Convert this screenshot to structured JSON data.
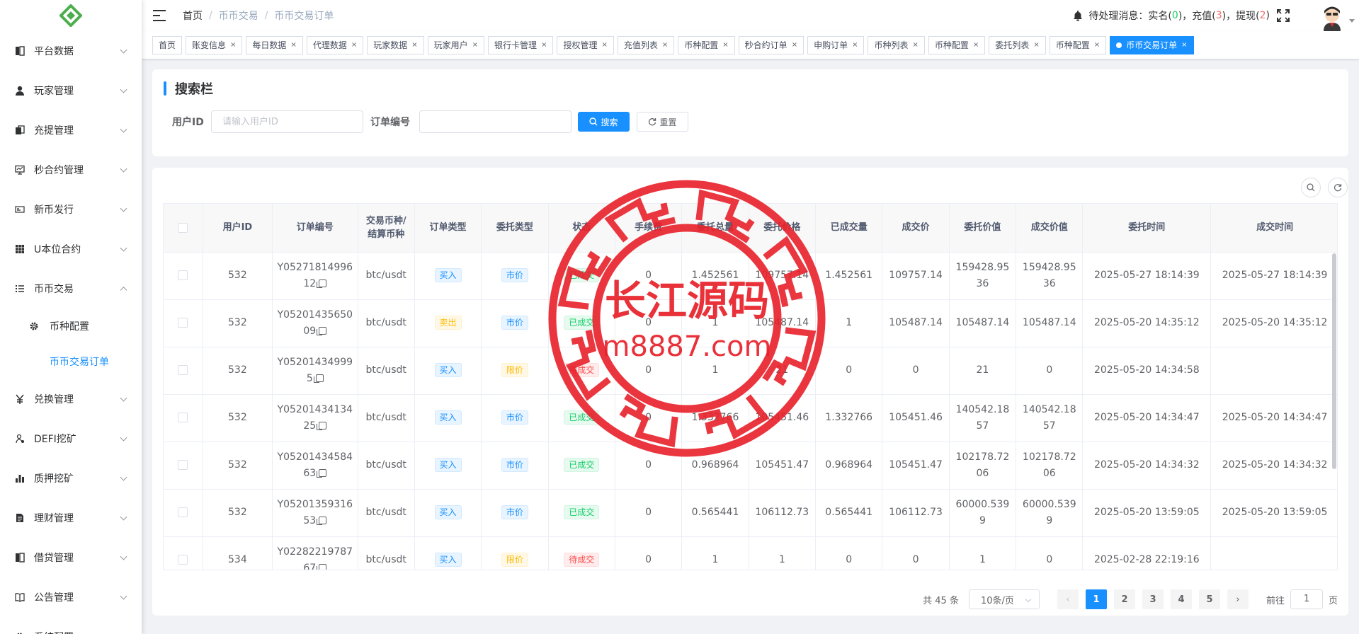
{
  "sidebar": {
    "menu": [
      {
        "label": "平台数据",
        "icon": "book-icon"
      },
      {
        "label": "玩家管理",
        "icon": "user-icon"
      },
      {
        "label": "充提管理",
        "icon": "copy-icon"
      },
      {
        "label": "秒合约管理",
        "icon": "monitor-icon"
      },
      {
        "label": "新币发行",
        "icon": "bank-icon"
      },
      {
        "label": "U本位合约",
        "icon": "grid-icon"
      },
      {
        "label": "币币交易",
        "icon": "list-icon"
      },
      {
        "label": "兑换管理",
        "icon": "yen-icon"
      },
      {
        "label": "DEFI挖矿",
        "icon": "coin-icon"
      },
      {
        "label": "质押挖矿",
        "icon": "bar-chart-icon"
      },
      {
        "label": "理财管理",
        "icon": "document-icon"
      },
      {
        "label": "借贷管理",
        "icon": "book-icon"
      },
      {
        "label": "公告管理",
        "icon": "open-book-icon"
      },
      {
        "label": "系统配置",
        "icon": "gear-icon"
      }
    ],
    "submenu": [
      {
        "label": "币种配置",
        "icon": "gear-icon"
      },
      {
        "label": "币币交易订单",
        "active": true
      }
    ]
  },
  "navbar": {
    "breadcrumb": [
      "首页",
      "币币交易",
      "币币交易订单"
    ],
    "notice": {
      "prefix": "待处理消息：实名(",
      "realname": "0",
      "mid1": ")，充值(",
      "recharge": "3",
      "mid2": ")，提现(",
      "withdraw": "2",
      "suffix": ")"
    }
  },
  "tags": [
    "首页",
    "账变信息",
    "每日数据",
    "代理数据",
    "玩家数据",
    "玩家用户",
    "银行卡管理",
    "授权管理",
    "充值列表",
    "币种配置",
    "秒合约订单",
    "申购订单",
    "币种列表",
    "币种配置",
    "委托列表",
    "币种配置",
    "币币交易订单"
  ],
  "search": {
    "title": "搜索栏",
    "user_id_label": "用户ID",
    "user_id_placeholder": "请输入用户ID",
    "order_no_label": "订单编号",
    "order_no_value": "",
    "search_button": "搜索",
    "reset_button": "重置"
  },
  "table": {
    "columns": [
      "用户ID",
      "订单编号",
      "交易币种/结算币种",
      "订单类型",
      "委托类型",
      "状态",
      "手续费",
      "委托总量",
      "委托价格",
      "已成交量",
      "成交价",
      "委托价值",
      "成交价值",
      "委托时间",
      "成交时间"
    ],
    "rows": [
      {
        "user_id": "532",
        "order_no": "Y0527181499612",
        "pair": "btc/usdt",
        "order_type": "买入",
        "entrust_type": "市价",
        "status": "已成交",
        "fee": "0",
        "total": "1.452561",
        "price": "109757.14",
        "filled": "1.452561",
        "deal_price": "109757.14",
        "entrust_value": "159428.9536",
        "deal_value": "159428.9536",
        "entrust_time": "2025-05-27 18:14:39",
        "deal_time": "2025-05-27 18:14:39"
      },
      {
        "user_id": "532",
        "order_no": "Y0520143565009",
        "pair": "btc/usdt",
        "order_type": "卖出",
        "entrust_type": "市价",
        "status": "已成交",
        "fee": "0",
        "total": "1",
        "price": "105487.14",
        "filled": "1",
        "deal_price": "105487.14",
        "entrust_value": "105487.14",
        "deal_value": "105487.14",
        "entrust_time": "2025-05-20 14:35:12",
        "deal_time": "2025-05-20 14:35:12"
      },
      {
        "user_id": "532",
        "order_no": "Y052014349995",
        "pair": "btc/usdt",
        "order_type": "买入",
        "entrust_type": "限价",
        "status": "待成交",
        "fee": "0",
        "total": "1",
        "price": "21",
        "filled": "0",
        "deal_price": "0",
        "entrust_value": "21",
        "deal_value": "0",
        "entrust_time": "2025-05-20 14:34:58",
        "deal_time": ""
      },
      {
        "user_id": "532",
        "order_no": "Y0520143413425",
        "pair": "btc/usdt",
        "order_type": "买入",
        "entrust_type": "市价",
        "status": "已成交",
        "fee": "0",
        "total": "1.332766",
        "price": "105451.46",
        "filled": "1.332766",
        "deal_price": "105451.46",
        "entrust_value": "140542.1857",
        "deal_value": "140542.1857",
        "entrust_time": "2025-05-20 14:34:47",
        "deal_time": "2025-05-20 14:34:47"
      },
      {
        "user_id": "532",
        "order_no": "Y0520143458463",
        "pair": "btc/usdt",
        "order_type": "买入",
        "entrust_type": "市价",
        "status": "已成交",
        "fee": "0",
        "total": "0.968964",
        "price": "105451.47",
        "filled": "0.968964",
        "deal_price": "105451.47",
        "entrust_value": "102178.7206",
        "deal_value": "102178.7206",
        "entrust_time": "2025-05-20 14:34:32",
        "deal_time": "2025-05-20 14:34:32"
      },
      {
        "user_id": "532",
        "order_no": "Y0520135931653",
        "pair": "btc/usdt",
        "order_type": "买入",
        "entrust_type": "市价",
        "status": "已成交",
        "fee": "0",
        "total": "0.565441",
        "price": "106112.73",
        "filled": "0.565441",
        "deal_price": "106112.73",
        "entrust_value": "60000.5399",
        "deal_value": "60000.5399",
        "entrust_time": "2025-05-20 13:59:05",
        "deal_time": "2025-05-20 13:59:05"
      },
      {
        "user_id": "534",
        "order_no": "Y0228221978767",
        "pair": "btc/usdt",
        "order_type": "买入",
        "entrust_type": "限价",
        "status": "待成交",
        "fee": "0",
        "total": "1",
        "price": "1",
        "filled": "0",
        "deal_price": "0",
        "entrust_value": "1",
        "deal_value": "0",
        "entrust_time": "2025-02-28 22:19:16",
        "deal_time": ""
      }
    ]
  },
  "pagination": {
    "total": "共 45 条",
    "page_size": "10条/页",
    "pages": [
      "1",
      "2",
      "3",
      "4",
      "5"
    ],
    "current": "1",
    "goto_label": "前往",
    "goto_value": "1",
    "goto_suffix": "页"
  },
  "watermark": {
    "title": "长江源码",
    "url": "m8887.com"
  },
  "colors": {
    "primary": "#1890ff",
    "success": "#13ce66",
    "danger": "#ff4949",
    "warning": "#ffba00",
    "watermark": "#e8202a"
  }
}
